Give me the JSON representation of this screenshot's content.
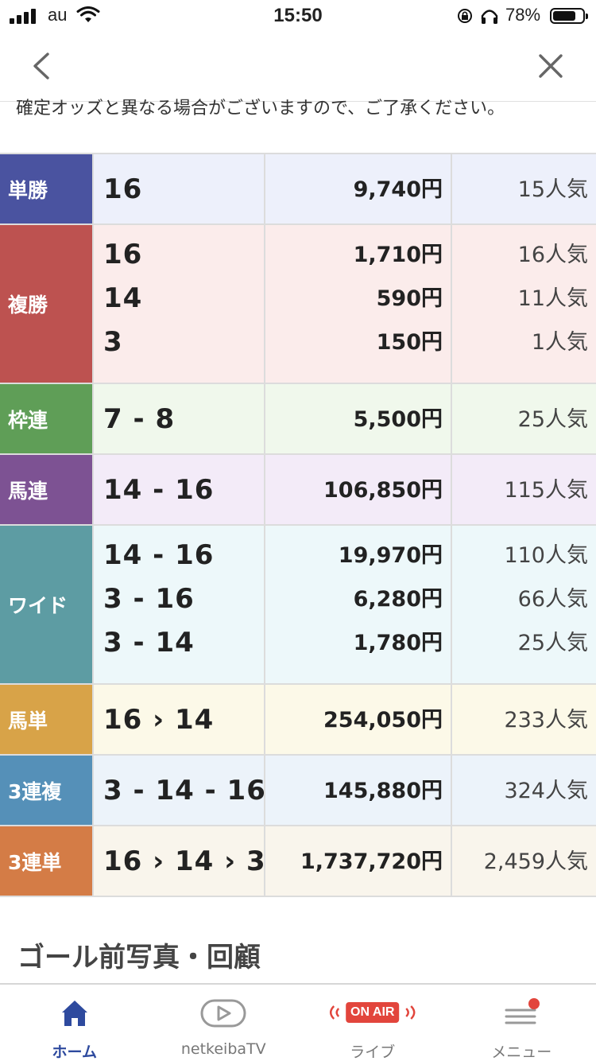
{
  "status_bar": {
    "carrier": "au",
    "time": "15:50",
    "battery_percent": "78%",
    "battery_level": 0.78
  },
  "nav": {
    "back_icon": "chevron-left-icon",
    "close_icon": "close-icon"
  },
  "notice": "確定オッズと異なる場合がございますので、ご了承ください。",
  "payouts": [
    {
      "type": "単勝",
      "color": "#4a53a0",
      "bg": "#edf0fb",
      "lines": [
        {
          "combo": "16",
          "payout": "9,740円",
          "popularity": "15人気"
        }
      ]
    },
    {
      "type": "複勝",
      "color": "#bd5250",
      "bg": "#fbeceb",
      "lines": [
        {
          "combo": "16",
          "payout": "1,710円",
          "popularity": "16人気"
        },
        {
          "combo": "14",
          "payout": "590円",
          "popularity": "11人気"
        },
        {
          "combo": "3",
          "payout": "150円",
          "popularity": "1人気"
        }
      ]
    },
    {
      "type": "枠連",
      "color": "#5f9e57",
      "bg": "#f0f8ec",
      "lines": [
        {
          "combo": "7 - 8",
          "payout": "5,500円",
          "popularity": "25人気"
        }
      ]
    },
    {
      "type": "馬連",
      "color": "#7d5293",
      "bg": "#f3ebf8",
      "lines": [
        {
          "combo": "14 - 16",
          "payout": "106,850円",
          "popularity": "115人気"
        }
      ]
    },
    {
      "type": "ワイド",
      "color": "#5d9ca3",
      "bg": "#edf8fa",
      "lines": [
        {
          "combo": "14 - 16",
          "payout": "19,970円",
          "popularity": "110人気"
        },
        {
          "combo": "3 - 16",
          "payout": "6,280円",
          "popularity": "66人気"
        },
        {
          "combo": "3 - 14",
          "payout": "1,780円",
          "popularity": "25人気"
        }
      ]
    },
    {
      "type": "馬単",
      "color": "#d8a348",
      "bg": "#fcf9e8",
      "lines": [
        {
          "combo": "16 › 14",
          "payout": "254,050円",
          "popularity": "233人気"
        }
      ]
    },
    {
      "type": "3連複",
      "color": "#5590b8",
      "bg": "#ecf3fa",
      "lines": [
        {
          "combo": "3 - 14 - 16",
          "payout": "145,880円",
          "popularity": "324人気"
        }
      ]
    },
    {
      "type": "3連単",
      "color": "#d47c46",
      "bg": "#f9f5ec",
      "lines": [
        {
          "combo": "16 › 14 › 3",
          "payout": "1,737,720円",
          "popularity": "2,459人気"
        }
      ]
    }
  ],
  "section_heading": "ゴール前写真・回顧",
  "tabs": [
    {
      "id": "home",
      "label": "ホーム",
      "icon": "home-icon",
      "active": true
    },
    {
      "id": "tv",
      "label": "netkeibaTV",
      "icon": "play-icon",
      "active": false
    },
    {
      "id": "live",
      "label": "ライブ",
      "icon": "on-air-icon",
      "badge": "ON AIR",
      "active": false
    },
    {
      "id": "menu",
      "label": "メニュー",
      "icon": "menu-icon",
      "active": false
    }
  ],
  "colors": {
    "accent": "#2e4a9e",
    "notification_dot": "#e2453c"
  }
}
